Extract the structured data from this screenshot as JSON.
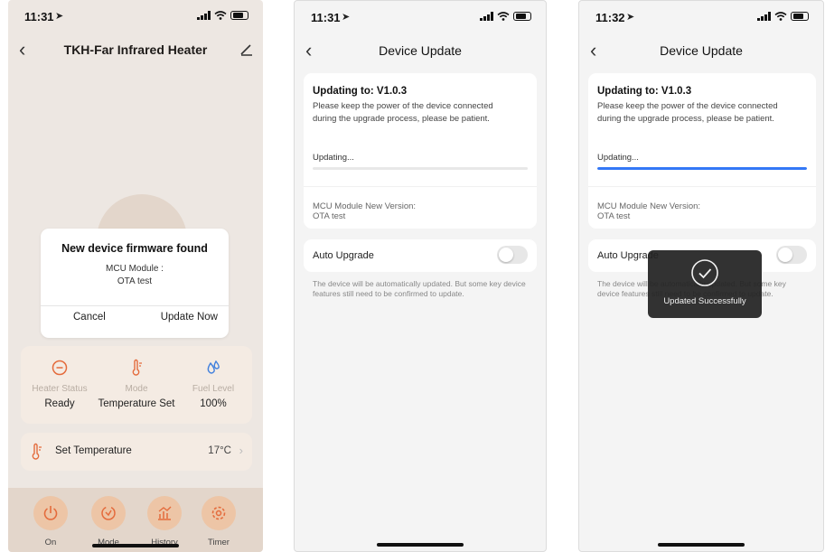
{
  "colors": {
    "heater_bg": "#ede7e2",
    "card_bg": "#f4ebe3",
    "accent_orange": "#edc5a6",
    "progress_blue": "#3478f6",
    "toast_bg": "#222222"
  },
  "screen1": {
    "status_time": "11:31",
    "title": "TKH-Far Infrared Heater",
    "icons": {
      "back": "chevron-left-icon",
      "edit": "edit-icon"
    },
    "dialog": {
      "title": "New device firmware found",
      "line1": "MCU Module :",
      "line2": "OTA test",
      "cancel": "Cancel",
      "confirm": "Update Now"
    },
    "stats": [
      {
        "icon": "power-minus-icon",
        "label": "Heater Status",
        "value": "Ready"
      },
      {
        "icon": "thermometer-icon",
        "label": "Mode",
        "value": "Temperature Set"
      },
      {
        "icon": "droplet-icon",
        "label": "Fuel Level",
        "value": "100%"
      }
    ],
    "set_temp": {
      "icon": "thermometer-icon",
      "label": "Set Temperature",
      "value": "17°C",
      "chevron": "›"
    },
    "bottom_nav": [
      {
        "icon": "power-icon",
        "label": "On"
      },
      {
        "icon": "mode-icon",
        "label": "Mode"
      },
      {
        "icon": "history-chart-icon",
        "label": "History"
      },
      {
        "icon": "timer-gear-icon",
        "label": "Timer"
      }
    ]
  },
  "screen2": {
    "status_time": "11:31",
    "title": "Device Update",
    "updating_to": "Updating to: V1.0.3",
    "desc": "Please keep the power of the device connected during the upgrade process, please be patient.",
    "progress_label": "Updating...",
    "progress": 0,
    "mcu_label": "MCU Module New Version:",
    "mcu_value": "OTA test",
    "auto_upgrade": "Auto Upgrade",
    "auto_upgrade_on": false,
    "note": "The device will be automatically updated. But some key device features still need to be confirmed to update."
  },
  "screen3": {
    "status_time": "11:32",
    "title": "Device Update",
    "updating_to": "Updating to: V1.0.3",
    "desc": "Please keep the power of the device connected during the upgrade process, please be patient.",
    "progress_label": "Updating...",
    "progress": 1.0,
    "mcu_label": "MCU Module New Version:",
    "mcu_value": "OTA test",
    "auto_upgrade": "Auto Upgrade",
    "auto_upgrade_on": false,
    "note": "The device will be automatically updated. But some key device features still need to be confirmed to update.",
    "toast": "Updated Successfully"
  }
}
